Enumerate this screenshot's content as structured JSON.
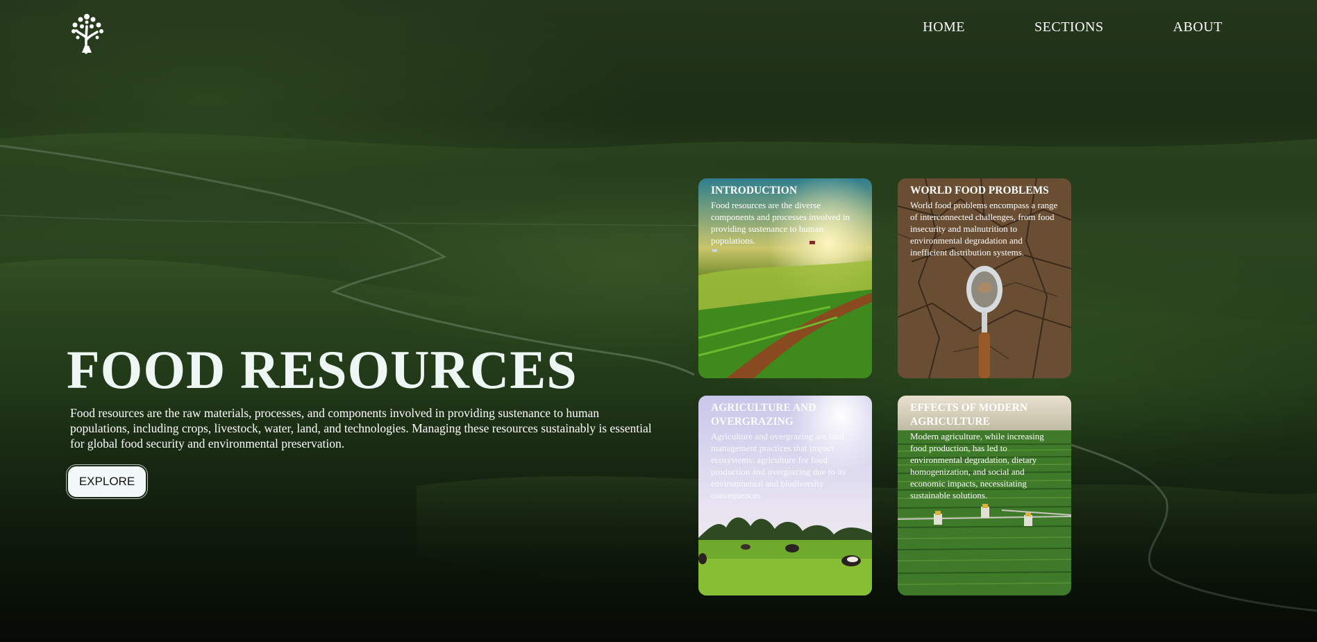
{
  "nav": {
    "logo_icon": "tree-icon",
    "links": [
      "HOME",
      "SECTIONS",
      "ABOUT"
    ]
  },
  "hero": {
    "title": "FOOD RESOURCES",
    "description": "Food resources are the raw materials, processes, and components involved in providing sustenance to human populations, including crops, livestock, water, land, and technologies. Managing these resources sustainably is essential for global food security and environmental preservation.",
    "button_label": "EXPLORE"
  },
  "cards": [
    {
      "title": "INTRODUCTION",
      "text": "Food resources are the diverse components and processes involved in providing sustenance to human populations."
    },
    {
      "title": "WORLD FOOD PROBLEMS",
      "text": "World food problems encompass a range of interconnected challenges, from food insecurity and malnutrition to environmental degradation and inefficient distribution systems."
    },
    {
      "title": "AGRICULTURE AND OVERGRAZING",
      "text": "Agriculture and overgrazing are land management practices that impact ecosystems: agriculture for food production and overgrazing due to its environmental and biodiversity consequences"
    },
    {
      "title": "EFFECTS OF MODERN AGRICULTURE",
      "text": "Modern agriculture, while increasing food production, has led to environmental degradation, dietary homogenization, and social and economic impacts, necessitating sustainable solutions."
    }
  ],
  "colors": {
    "title": "#eef7f4",
    "button_bg": "#f3f8f8",
    "landscape_dark": "#0d170b",
    "landscape_mid": "#2f4a22"
  }
}
